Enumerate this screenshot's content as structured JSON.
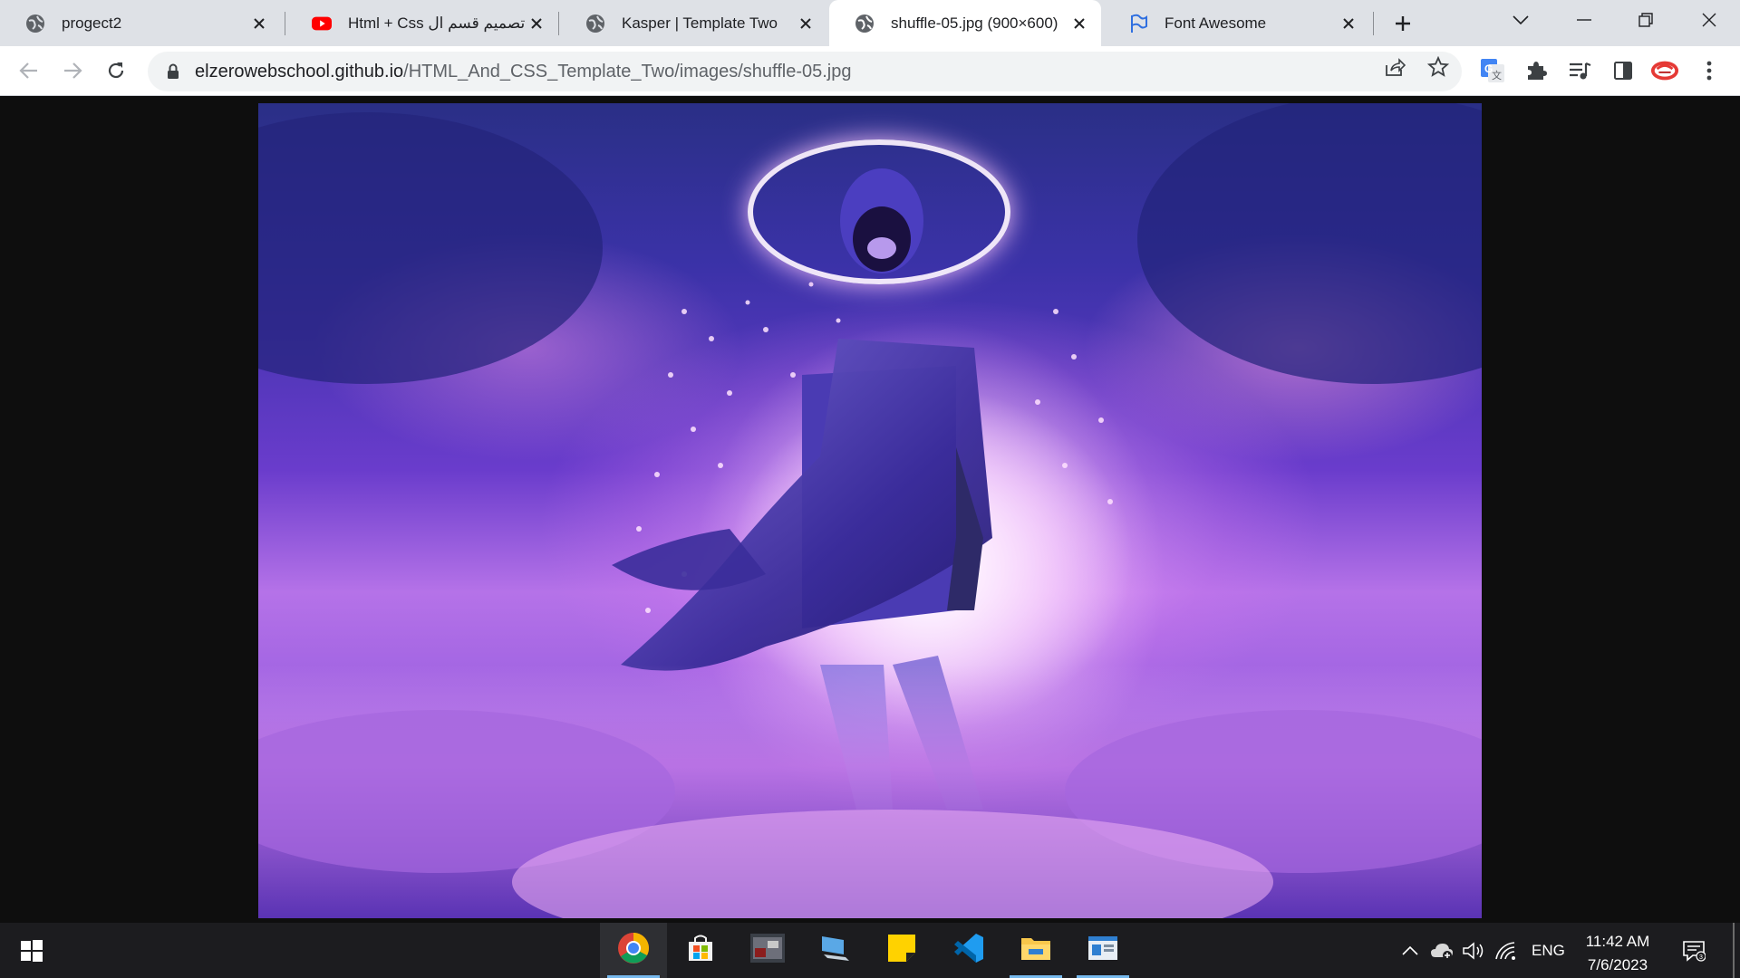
{
  "browser": {
    "tabs": [
      {
        "title": "progect2",
        "icon": "globe-icon",
        "active": false
      },
      {
        "title": "Html + Css تصميم قسم ال",
        "icon": "youtube-icon",
        "active": false
      },
      {
        "title": "Kasper | Template Two",
        "icon": "globe-icon",
        "active": false
      },
      {
        "title": "shuffle-05.jpg (900×600)",
        "icon": "globe-icon",
        "active": true
      },
      {
        "title": "Font Awesome",
        "icon": "flag-icon",
        "active": false
      }
    ],
    "address": {
      "host": "elzerowebschool.github.io",
      "path": "/HTML_And_CSS_Template_Two/images/shuffle-05.jpg"
    }
  },
  "viewport": {
    "image_alt": "shuffle-05.jpg",
    "image_width": 900,
    "image_height": 600
  },
  "taskbar": {
    "apps": [
      "chrome-icon",
      "store-icon",
      "game-icon",
      "pc-icon",
      "sticky-notes-icon",
      "vscode-icon",
      "file-explorer-icon",
      "app-window-icon"
    ],
    "language": "ENG",
    "time": "11:42 AM",
    "date": "7/6/2023"
  },
  "colors": {
    "tabstrip_bg": "#dee1e6",
    "toolbar_bg": "#ffffff",
    "omnibox_bg": "#f1f3f4",
    "viewport_bg": "#0e0e0e",
    "taskbar_bg": "#1c1c1f",
    "accent": "#1a73e8"
  }
}
